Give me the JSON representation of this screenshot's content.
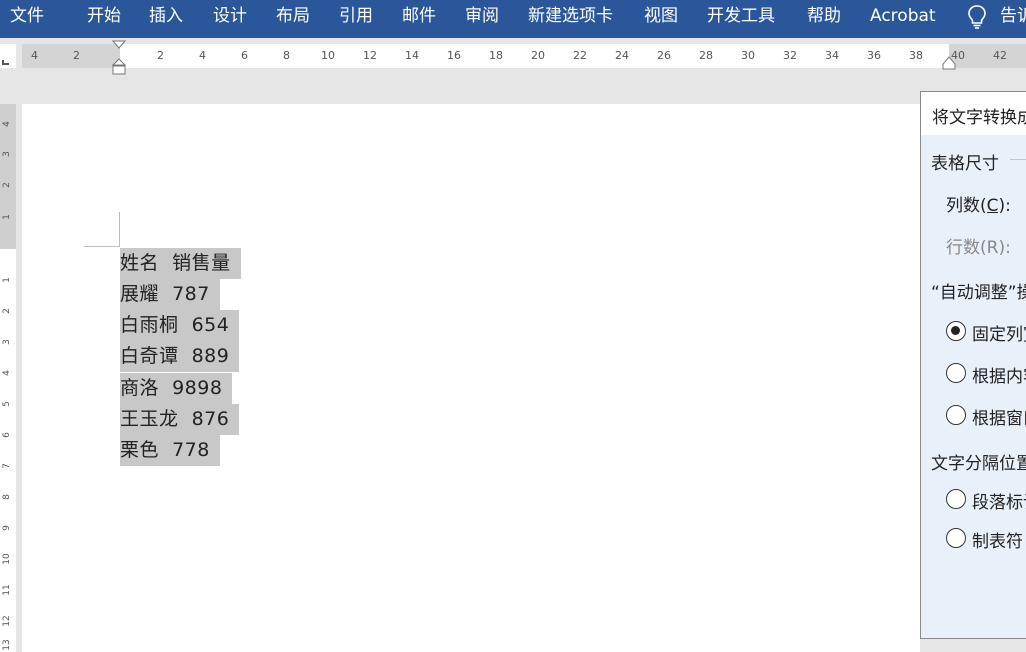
{
  "ribbon": {
    "tabs": [
      "文件",
      "开始",
      "插入",
      "设计",
      "布局",
      "引用",
      "邮件",
      "审阅",
      "新建选项卡",
      "视图",
      "开发工具",
      "帮助",
      "Acrobat"
    ],
    "tell_me": "告诉",
    "color": "#2b579a"
  },
  "ruler": {
    "h_labels": [
      "4",
      "2",
      "2",
      "4",
      "6",
      "8",
      "10",
      "12",
      "14",
      "16",
      "18",
      "20",
      "22",
      "24",
      "26",
      "28",
      "30",
      "32",
      "34",
      "36",
      "38",
      "40",
      "42"
    ],
    "v_labels_top": [
      "4",
      "3",
      "2",
      "1"
    ],
    "v_labels": [
      "1",
      "2",
      "3",
      "4",
      "5",
      "6",
      "7",
      "8",
      "9",
      "10",
      "11",
      "12",
      "13"
    ]
  },
  "document": {
    "lines": [
      "姓名  销售量",
      "展耀  787",
      "白雨桐  654",
      "白奇谭  889",
      "商洛  9898",
      "王玉龙  876",
      "栗色  778"
    ],
    "highlight_color": "#c8c8c8"
  },
  "dialog": {
    "title": "将文字转换成表格",
    "table_size_label": "表格尺寸",
    "columns_label": "列数(C):",
    "columns_hotkey": "C",
    "rows_label": "行数(R):",
    "autofit_label": "“自动调整”操作",
    "autofit_options": [
      "固定列宽",
      "根据内容调整表格",
      "根据窗口调整表格"
    ],
    "autofit_selected": 0,
    "separator_label": "文字分隔位置",
    "separator_options": [
      "段落标记",
      "制表符"
    ]
  }
}
